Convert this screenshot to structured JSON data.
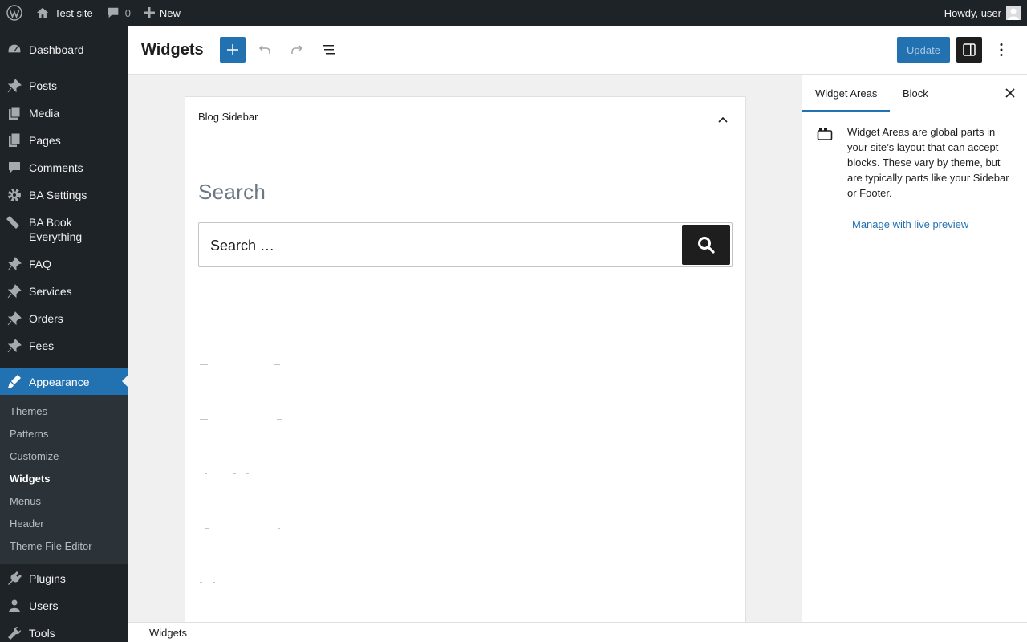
{
  "adminbar": {
    "site_name": "Test site",
    "comments_count": "0",
    "new_label": "New",
    "greeting": "Howdy, user"
  },
  "sidebar": {
    "items": [
      {
        "label": "Dashboard",
        "icon": "dashboard-icon"
      },
      {
        "label": "Posts",
        "icon": "pin-icon"
      },
      {
        "label": "Media",
        "icon": "media-icon"
      },
      {
        "label": "Pages",
        "icon": "pages-icon"
      },
      {
        "label": "Comments",
        "icon": "comment-icon"
      },
      {
        "label": "BA Settings",
        "icon": "gear-icon"
      },
      {
        "label": "BA Book Everything",
        "icon": "tickets-icon"
      },
      {
        "label": "FAQ",
        "icon": "pin-icon"
      },
      {
        "label": "Services",
        "icon": "pin-icon"
      },
      {
        "label": "Orders",
        "icon": "pin-icon"
      },
      {
        "label": "Fees",
        "icon": "pin-icon"
      },
      {
        "label": "Appearance",
        "icon": "brush-icon"
      },
      {
        "label": "Plugins",
        "icon": "plug-icon"
      },
      {
        "label": "Users",
        "icon": "user-icon"
      },
      {
        "label": "Tools",
        "icon": "wrench-icon"
      }
    ],
    "submenu": [
      "Themes",
      "Patterns",
      "Customize",
      "Widgets",
      "Menus",
      "Header",
      "Theme File Editor"
    ],
    "current_submenu": "Widgets"
  },
  "header": {
    "title": "Widgets",
    "update_label": "Update"
  },
  "canvas": {
    "widget_area_title": "Blog Sidebar",
    "search_heading": "Search",
    "search_placeholder": "Search …"
  },
  "settings": {
    "tabs": [
      "Widget Areas",
      "Block"
    ],
    "active_tab": "Widget Areas",
    "description": "Widget Areas are global parts in your site’s layout that can accept blocks. These vary by theme, but are typically parts like your Sidebar or Footer.",
    "link": "Manage with live preview"
  },
  "footer": {
    "breadcrumb": "Widgets"
  },
  "colors": {
    "admin_dark": "#1d2327",
    "accent": "#2271b1",
    "submenu_bg": "#2c3338"
  }
}
